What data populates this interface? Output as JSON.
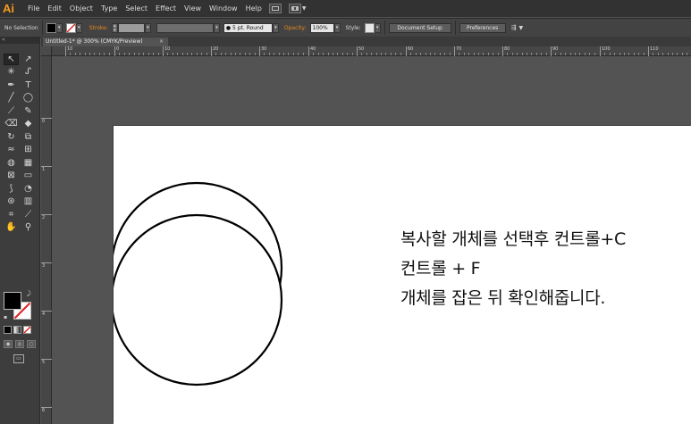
{
  "app": {
    "logo": "Ai"
  },
  "menubar": {
    "items": [
      "File",
      "Edit",
      "Object",
      "Type",
      "Select",
      "Effect",
      "View",
      "Window",
      "Help"
    ]
  },
  "controlbar": {
    "selection_label": "No Selection",
    "stroke_label": "Stroke:",
    "brush_value": "5 pt. Round",
    "opacity_label": "Opacity:",
    "opacity_value": "100%",
    "style_label": "Style:",
    "document_setup": "Document Setup",
    "preferences": "Preferences"
  },
  "document": {
    "tab_title": "Untitled-1* @ 300% (CMYK/Preview)",
    "tab_close": "×"
  },
  "rulers": {
    "h_labels": [
      "10",
      "0",
      "10",
      "20",
      "30",
      "40",
      "50",
      "60",
      "70",
      "80",
      "90",
      "100",
      "110"
    ],
    "v_labels": [
      "0",
      "1",
      "2",
      "3",
      "4",
      "5",
      "6"
    ]
  },
  "artboard": {
    "note_lines": [
      "복사할 개체를 선택후 컨트롤+C",
      "컨트롤 + F",
      "개체를 잡은 뒤 확인해줍니다."
    ]
  },
  "colors": {
    "accent": "#f79a1c",
    "stroke_label": "#e88b1b",
    "fill": "#000000",
    "stroke": "#ffffff"
  }
}
